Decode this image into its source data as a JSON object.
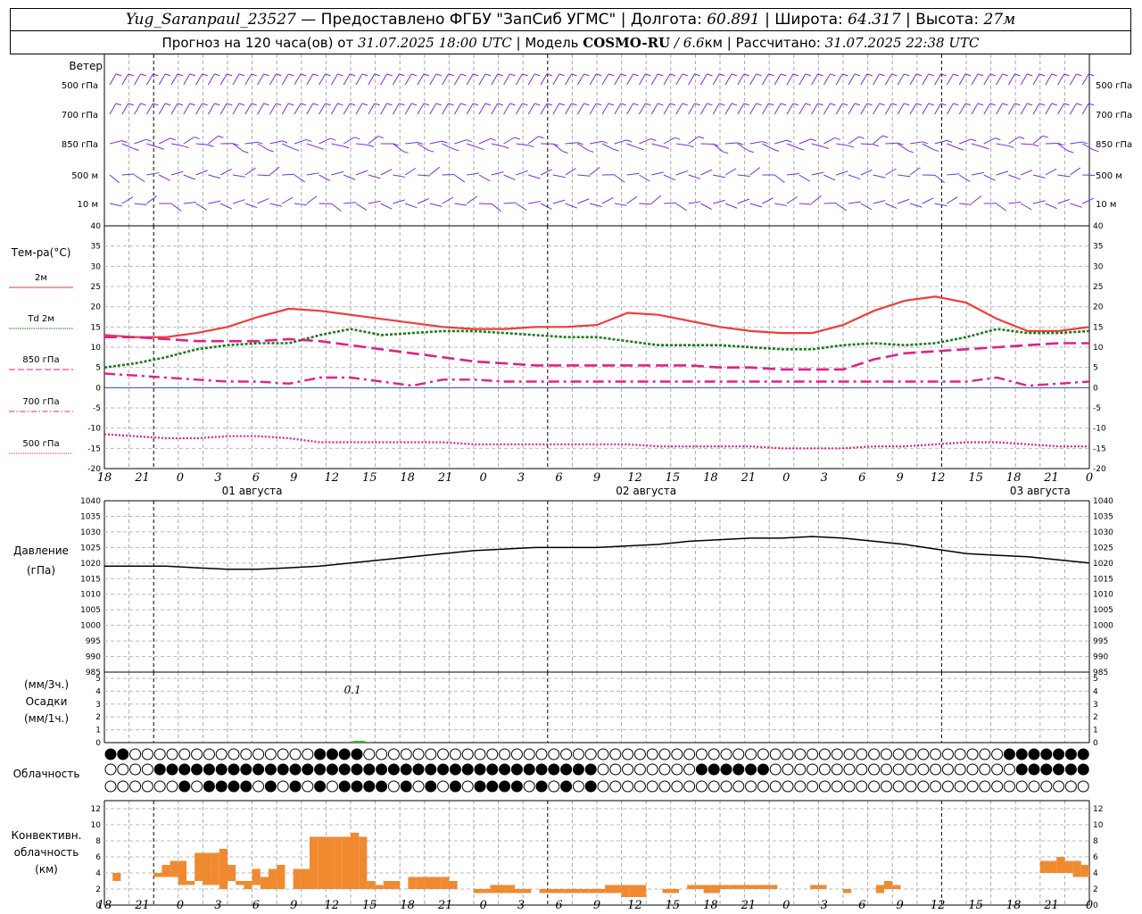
{
  "header": {
    "station": "Yug_Saranpaul_23527",
    "provider": "— Предоставлено ФГБУ \"ЗапСиб УГМС\"",
    "lon_label": "| Долгота:",
    "lon": "60.891",
    "lat_label": "| Широта:",
    "lat": "64.317",
    "alt_label": "| Высота:",
    "alt": "27м",
    "forecast_label": "Прогноз на 120 часа(ов) от",
    "issued": "31.07.2025 18:00 UTC",
    "model_label": "| Модель",
    "model": "COSMO-RU",
    "resolution": "/ 6.6",
    "resolution_unit": "км",
    "computed_label": "| Рассчитано:",
    "computed": "31.07.2025 22:38 UTC"
  },
  "labels": {
    "wind": "Ветер",
    "temp": "Тем-ра(°С)",
    "pressure": "Давление",
    "pressure_unit": "(гПа)",
    "precip_unit1": "(мм/3ч.)",
    "precip": "Осадки",
    "precip_unit2": "(мм/1ч.)",
    "cloud": "Облачность",
    "conv1": "Конвективн.",
    "conv2": "облачность",
    "conv_unit": "(км)"
  },
  "wind_levels": [
    "500 гПа",
    "700 гПа",
    "850 гПа",
    "500 м",
    "10  м"
  ],
  "time_ticks": [
    "18",
    "21",
    "0",
    "3",
    "6",
    "9",
    "12",
    "15",
    "18",
    "21",
    "0",
    "3",
    "6",
    "9",
    "12",
    "15",
    "18",
    "21",
    "0",
    "3",
    "6",
    "9",
    "12",
    "15",
    "18",
    "21",
    "0"
  ],
  "date_labels": [
    "01 августа",
    "02 августа",
    "03 августа"
  ],
  "precip_note": "0.1",
  "colors": {
    "wind": "#7b2de0",
    "t2m": "#f03c3c",
    "td": "#1a7a1a",
    "t850": "#e0208a",
    "precip": "#22c022",
    "conv": "#f08a30"
  },
  "chart_data": [
    {
      "type": "line",
      "title": "Тем-ра(°С)",
      "x_hours": [
        0,
        3,
        6,
        9,
        12,
        15,
        18,
        21,
        24,
        27,
        30,
        33,
        36,
        39,
        42,
        45,
        48,
        51,
        54,
        57,
        60,
        63,
        66,
        69,
        72,
        75,
        78,
        81,
        84,
        87,
        90,
        93,
        96,
        99,
        102,
        105,
        108,
        111,
        114,
        117,
        120
      ],
      "ylim": [
        -20,
        40
      ],
      "yticks": [
        -20,
        -15,
        -10,
        -5,
        0,
        5,
        10,
        15,
        20,
        25,
        30,
        35,
        40
      ],
      "series": [
        {
          "name": "2м",
          "style": "solid",
          "color": "#f03c3c",
          "values": [
            13.0,
            12.5,
            12.5,
            13.5,
            15.0,
            17.5,
            19.5,
            19.0,
            18.0,
            17.0,
            16.0,
            15.0,
            14.5,
            14.5,
            15.0,
            15.0,
            15.5,
            18.5,
            18.0,
            16.5,
            15.0,
            14.0,
            13.5,
            13.5,
            15.5,
            19.0,
            21.5,
            22.5,
            21.0,
            17.0,
            14.0,
            14.0,
            15.0
          ]
        },
        {
          "name": "Td  2м",
          "style": "dotted",
          "color": "#1a7a1a",
          "values": [
            5.0,
            6.0,
            7.5,
            9.5,
            10.5,
            11.0,
            11.0,
            13.0,
            14.5,
            13.0,
            13.5,
            14.0,
            14.0,
            13.5,
            13.0,
            12.5,
            12.5,
            11.5,
            10.5,
            10.5,
            10.5,
            10.0,
            9.5,
            9.5,
            10.5,
            11.0,
            10.5,
            11.0,
            12.5,
            14.5,
            13.5,
            13.5,
            14.0
          ]
        },
        {
          "name": "850 гПа",
          "style": "dashed",
          "color": "#e0208a",
          "values": [
            12.5,
            12.5,
            12.0,
            11.5,
            11.5,
            11.5,
            12.0,
            11.5,
            10.5,
            9.5,
            8.5,
            7.5,
            6.5,
            6.0,
            5.5,
            5.5,
            5.5,
            5.5,
            5.5,
            5.5,
            5.0,
            5.0,
            4.5,
            4.5,
            4.5,
            7.0,
            8.5,
            9.0,
            9.5,
            10.0,
            10.5,
            11.0,
            11.0
          ]
        },
        {
          "name": "700 гПа",
          "style": "dashdot",
          "color": "#e0208a",
          "values": [
            3.5,
            3.0,
            2.5,
            2.0,
            1.5,
            1.5,
            1.0,
            2.5,
            2.5,
            1.5,
            0.5,
            2.0,
            2.0,
            1.5,
            1.5,
            1.5,
            1.5,
            1.5,
            1.5,
            1.5,
            1.5,
            1.5,
            1.5,
            1.5,
            1.5,
            1.5,
            1.5,
            1.5,
            1.5,
            2.5,
            0.5,
            1.0,
            1.5
          ]
        },
        {
          "name": "500 гПа",
          "style": "fine-dotted",
          "color": "#e0208a",
          "values": [
            -11.5,
            -12.0,
            -12.5,
            -12.5,
            -12.0,
            -12.0,
            -12.5,
            -13.5,
            -13.5,
            -13.5,
            -13.5,
            -13.5,
            -14.0,
            -14.0,
            -14.0,
            -14.0,
            -14.0,
            -14.0,
            -14.5,
            -14.5,
            -14.5,
            -14.5,
            -15.0,
            -15.0,
            -15.0,
            -14.5,
            -14.5,
            -14.0,
            -13.5,
            -13.5,
            -14.0,
            -14.5,
            -14.5
          ]
        }
      ]
    },
    {
      "type": "line",
      "title": "Давление",
      "ylabel": "(гПа)",
      "ylim": [
        985,
        1040
      ],
      "yticks": [
        985,
        990,
        995,
        1000,
        1005,
        1010,
        1015,
        1020,
        1025,
        1030,
        1035,
        1040
      ],
      "series": [
        {
          "name": "Давление",
          "color": "#000000",
          "values": [
            1019,
            1019,
            1019,
            1018.5,
            1018,
            1018,
            1018.5,
            1019,
            1020,
            1021,
            1022,
            1023,
            1024,
            1024.5,
            1025,
            1025,
            1025,
            1025.5,
            1026,
            1027,
            1027.5,
            1028,
            1028,
            1028.5,
            1028,
            1027,
            1026,
            1024.5,
            1023,
            1022.5,
            1022,
            1021,
            1020
          ]
        }
      ]
    },
    {
      "type": "bar",
      "title": "Осадки",
      "ylim": [
        0,
        5
      ],
      "yticks": [
        0,
        1,
        2,
        3,
        4,
        5
      ],
      "bars": [
        {
          "hour": 31,
          "value": 0.1,
          "color": "#22c022"
        }
      ]
    },
    {
      "type": "bar",
      "title": "Конвективн. облачность",
      "ylabel": "(км)",
      "ylim": [
        0,
        13
      ],
      "yticks": [
        0,
        2,
        4,
        6,
        8,
        10,
        12
      ],
      "bars": [
        {
          "hour": 1,
          "base": 3,
          "top": 4
        },
        {
          "hour": 6,
          "base": 3.5,
          "top": 4
        },
        {
          "hour": 7,
          "base": 3.5,
          "top": 5
        },
        {
          "hour": 8,
          "base": 3.5,
          "top": 5.5
        },
        {
          "hour": 9,
          "base": 2.5,
          "top": 5.5
        },
        {
          "hour": 10,
          "base": 2.5,
          "top": 3
        },
        {
          "hour": 11,
          "base": 3,
          "top": 6.5
        },
        {
          "hour": 12,
          "base": 2.5,
          "top": 6.5
        },
        {
          "hour": 13,
          "base": 2.5,
          "top": 6.5
        },
        {
          "hour": 14,
          "base": 2,
          "top": 7
        },
        {
          "hour": 15,
          "base": 3,
          "top": 5
        },
        {
          "hour": 16,
          "base": 2.5,
          "top": 3
        },
        {
          "hour": 17,
          "base": 2,
          "top": 3
        },
        {
          "hour": 18,
          "base": 2.5,
          "top": 4.5
        },
        {
          "hour": 19,
          "base": 2,
          "top": 3.5
        },
        {
          "hour": 20,
          "base": 2,
          "top": 4.5
        },
        {
          "hour": 21,
          "base": 2,
          "top": 5
        },
        {
          "hour": 23,
          "base": 2,
          "top": 4.5
        },
        {
          "hour": 24,
          "base": 2,
          "top": 4.5
        },
        {
          "hour": 25,
          "base": 2,
          "top": 8.5
        },
        {
          "hour": 26,
          "base": 2,
          "top": 8.5
        },
        {
          "hour": 27,
          "base": 2,
          "top": 8.5
        },
        {
          "hour": 28,
          "base": 2,
          "top": 8.5
        },
        {
          "hour": 29,
          "base": 2,
          "top": 8.5
        },
        {
          "hour": 30,
          "base": 2,
          "top": 9
        },
        {
          "hour": 31,
          "base": 2,
          "top": 8.5
        },
        {
          "hour": 32,
          "base": 2,
          "top": 3
        },
        {
          "hour": 33,
          "base": 2,
          "top": 2.5
        },
        {
          "hour": 34,
          "base": 2,
          "top": 3
        },
        {
          "hour": 35,
          "base": 2,
          "top": 3
        },
        {
          "hour": 37,
          "base": 2,
          "top": 3.5
        },
        {
          "hour": 38,
          "base": 2,
          "top": 3.5
        },
        {
          "hour": 39,
          "base": 2,
          "top": 3.5
        },
        {
          "hour": 40,
          "base": 2,
          "top": 3.5
        },
        {
          "hour": 41,
          "base": 2,
          "top": 3.5
        },
        {
          "hour": 42,
          "base": 2,
          "top": 3
        },
        {
          "hour": 45,
          "base": 1.5,
          "top": 2
        },
        {
          "hour": 46,
          "base": 1.5,
          "top": 2
        },
        {
          "hour": 47,
          "base": 1.5,
          "top": 2.5
        },
        {
          "hour": 48,
          "base": 1.5,
          "top": 2.5
        },
        {
          "hour": 49,
          "base": 1.5,
          "top": 2.5
        },
        {
          "hour": 50,
          "base": 1.5,
          "top": 2
        },
        {
          "hour": 51,
          "base": 1.5,
          "top": 2
        },
        {
          "hour": 53,
          "base": 1.5,
          "top": 2
        },
        {
          "hour": 54,
          "base": 1.5,
          "top": 2
        },
        {
          "hour": 55,
          "base": 1.5,
          "top": 2
        },
        {
          "hour": 56,
          "base": 1.5,
          "top": 2
        },
        {
          "hour": 57,
          "base": 1.5,
          "top": 2
        },
        {
          "hour": 58,
          "base": 1.5,
          "top": 2
        },
        {
          "hour": 59,
          "base": 1.5,
          "top": 2
        },
        {
          "hour": 60,
          "base": 1.5,
          "top": 2
        },
        {
          "hour": 61,
          "base": 1.5,
          "top": 2.5
        },
        {
          "hour": 62,
          "base": 1.5,
          "top": 2.5
        },
        {
          "hour": 63,
          "base": 1,
          "top": 2.5
        },
        {
          "hour": 64,
          "base": 1,
          "top": 2.5
        },
        {
          "hour": 65,
          "base": 1,
          "top": 2.5
        },
        {
          "hour": 68,
          "base": 1.5,
          "top": 2
        },
        {
          "hour": 69,
          "base": 1.5,
          "top": 2
        },
        {
          "hour": 71,
          "base": 2,
          "top": 2.5
        },
        {
          "hour": 72,
          "base": 2,
          "top": 2.5
        },
        {
          "hour": 73,
          "base": 1.5,
          "top": 2.5
        },
        {
          "hour": 74,
          "base": 1.5,
          "top": 2.5
        },
        {
          "hour": 75,
          "base": 2,
          "top": 2.5
        },
        {
          "hour": 76,
          "base": 2,
          "top": 2.5
        },
        {
          "hour": 77,
          "base": 2,
          "top": 2.5
        },
        {
          "hour": 78,
          "base": 2,
          "top": 2.5
        },
        {
          "hour": 79,
          "base": 2,
          "top": 2.5
        },
        {
          "hour": 80,
          "base": 2,
          "top": 2.5
        },
        {
          "hour": 81,
          "base": 2,
          "top": 2.5
        },
        {
          "hour": 86,
          "base": 2,
          "top": 2.5
        },
        {
          "hour": 87,
          "base": 2,
          "top": 2.5
        },
        {
          "hour": 90,
          "base": 1.5,
          "top": 2
        },
        {
          "hour": 94,
          "base": 1.5,
          "top": 2.5
        },
        {
          "hour": 95,
          "base": 2,
          "top": 3
        },
        {
          "hour": 96,
          "base": 2,
          "top": 2.5
        },
        {
          "hour": 114,
          "base": 4,
          "top": 5.5
        },
        {
          "hour": 115,
          "base": 4,
          "top": 5.5
        },
        {
          "hour": 116,
          "base": 4,
          "top": 6
        },
        {
          "hour": 117,
          "base": 4,
          "top": 5.5
        },
        {
          "hour": 118,
          "base": 3.5,
          "top": 5.5
        },
        {
          "hour": 119,
          "base": 3.5,
          "top": 5
        }
      ]
    }
  ]
}
